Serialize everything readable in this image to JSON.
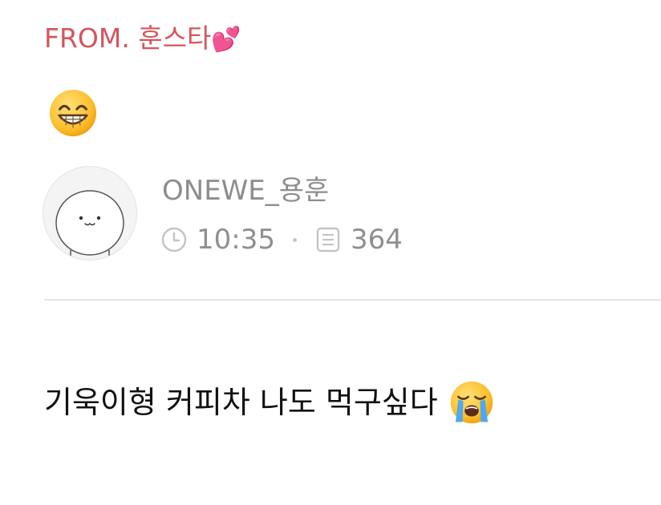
{
  "post": {
    "from_label": "FROM. 훈스타",
    "heart_emoji": "💕",
    "top_emoji": "grinning-face-with-smiling-eyes",
    "author": {
      "name": "ONEWE_용훈",
      "avatar_icon": "white-cat-face-avatar"
    },
    "meta": {
      "time": "10:35",
      "time_icon": "clock-icon",
      "post_count": "364",
      "count_icon": "document-icon"
    },
    "message": "기욱이형 커피차 나도 먹구싶다",
    "message_emoji": "loudly-crying-face"
  },
  "colors": {
    "from_text": "#d4555b",
    "meta_text": "#8f8f8f",
    "message_text": "#111111",
    "divider": "#e6e6e6"
  }
}
